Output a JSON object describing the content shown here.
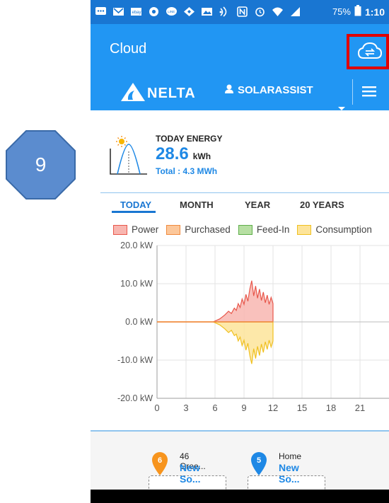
{
  "step": {
    "number": "9",
    "color": "#5b8ccf"
  },
  "status_bar": {
    "icons": [
      "chat-icon",
      "gmail-icon",
      "ebay-icon",
      "chrome-icon",
      "line-icon",
      "nav-icon",
      "image-icon",
      "nfc-signal-icon",
      "n-icon",
      "alarm-icon",
      "wifi-icon",
      "signal-icon"
    ],
    "battery": "75%",
    "time": "1:10"
  },
  "app_bar": {
    "title": "Cloud",
    "action_icon": "cloud-sync-icon",
    "highlight_color": "#e00000"
  },
  "brand": {
    "logo_text": "NELTA",
    "user": "SOLARASSIST",
    "menu_icon": "hamburger-icon"
  },
  "energy": {
    "label": "TODAY ENERGY",
    "value": "28.6",
    "unit": "kWh",
    "total": "Total : 4.3 MWh"
  },
  "tabs": [
    {
      "label": "TODAY",
      "active": true
    },
    {
      "label": "MONTH",
      "active": false
    },
    {
      "label": "YEAR",
      "active": false
    },
    {
      "label": "20 YEARS",
      "active": false
    }
  ],
  "chart_data": {
    "type": "area",
    "legend": [
      {
        "name": "Power",
        "fill": "#f8b6b0",
        "stroke": "#e8574b"
      },
      {
        "name": "Purchased",
        "fill": "#fcc79a",
        "stroke": "#f08a3e"
      },
      {
        "name": "Feed-In",
        "fill": "#b7dfa3",
        "stroke": "#5fae4a"
      },
      {
        "name": "Consumption",
        "fill": "#fde49a",
        "stroke": "#f0c020"
      }
    ],
    "y_ticks": [
      "20.0 kW",
      "10.0 kW",
      "0.0 kW",
      "-10.0 kW",
      "-20.0 kW"
    ],
    "x_ticks": [
      "0",
      "3",
      "6",
      "9",
      "12",
      "15",
      "18",
      "21"
    ],
    "ylim": [
      -20,
      20
    ],
    "xlim": [
      0,
      24
    ],
    "grid": true,
    "series": [
      {
        "name": "Power",
        "x": [
          0,
          5.8,
          6.5,
          7.0,
          7.4,
          7.7,
          8.0,
          8.2,
          8.4,
          8.6,
          8.8,
          9.0,
          9.2,
          9.4,
          9.6,
          9.8,
          10.0,
          10.2,
          10.4,
          10.6,
          10.8,
          11.0,
          11.2,
          11.4,
          11.6,
          11.8,
          12.0
        ],
        "values": [
          0,
          0,
          0.8,
          1.8,
          2.8,
          2.2,
          3.6,
          3.0,
          4.8,
          3.8,
          6.0,
          4.6,
          7.2,
          5.4,
          8.6,
          10.8,
          6.8,
          9.4,
          6.2,
          8.6,
          5.6,
          7.8,
          5.0,
          7.0,
          4.6,
          6.4,
          4.8
        ]
      },
      {
        "name": "Consumption",
        "x": [
          0,
          5.8,
          6.5,
          7.0,
          7.4,
          7.7,
          8.0,
          8.2,
          8.4,
          8.6,
          8.8,
          9.0,
          9.2,
          9.4,
          9.6,
          9.8,
          10.0,
          10.2,
          10.4,
          10.6,
          10.8,
          11.0,
          11.2,
          11.4,
          11.6,
          11.8,
          12.0
        ],
        "values": [
          0,
          0,
          -0.8,
          -1.8,
          -2.8,
          -2.2,
          -3.6,
          -3.2,
          -5.0,
          -4.0,
          -6.2,
          -4.8,
          -7.4,
          -5.6,
          -8.8,
          -11.0,
          -7.0,
          -9.6,
          -6.4,
          -8.8,
          -5.8,
          -8.0,
          -5.2,
          -7.2,
          -4.8,
          -6.6,
          -5.0
        ]
      }
    ]
  },
  "sites": [
    {
      "badge": "6",
      "badge_color": "#f7941d",
      "name": "46 Gree...",
      "status": "New So..."
    },
    {
      "badge": "5",
      "badge_color": "#1e88e5",
      "name": "Home",
      "status": "New So..."
    }
  ]
}
